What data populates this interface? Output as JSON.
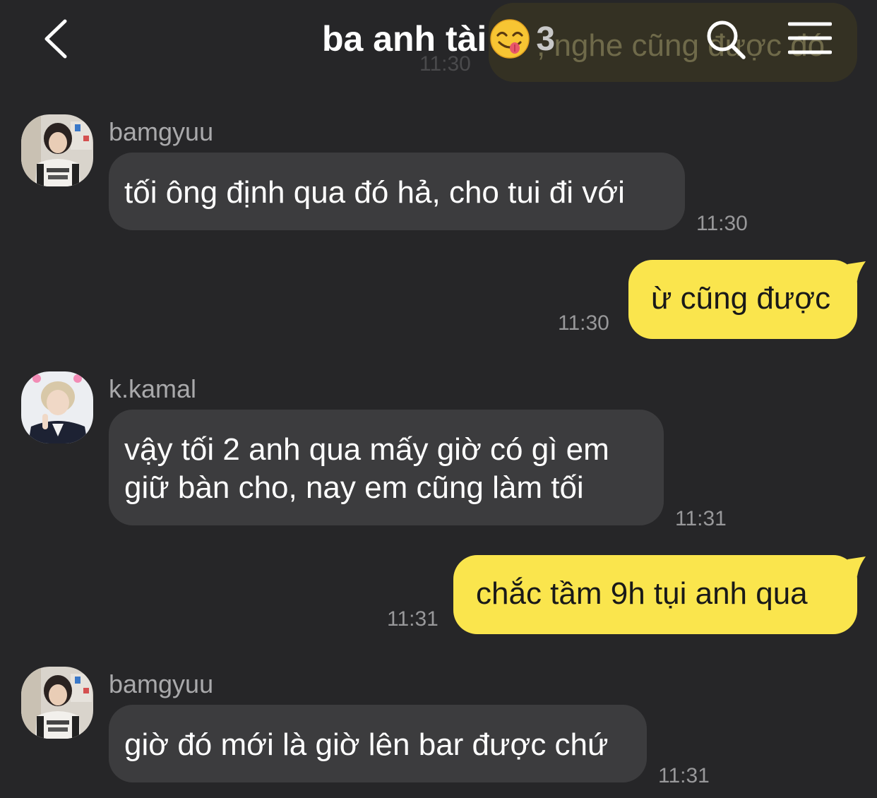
{
  "header": {
    "title": "ba anh tài",
    "member_count": "3",
    "behind_preview": {
      "text": ", nghe cũng được đó",
      "time": "11:30"
    }
  },
  "messages": [
    {
      "sender": "bamgyuu",
      "text": "tối ông định qua đó hả, cho tui đi với",
      "time": "11:30",
      "direction": "incoming"
    },
    {
      "text": "ừ cũng được",
      "time": "11:30",
      "direction": "outgoing"
    },
    {
      "sender": "k.kamal",
      "text_line1": "vậy tối 2 anh qua mấy giờ có gì em",
      "text_line2": "giữ bàn cho, nay em cũng làm tối",
      "time": "11:31",
      "direction": "incoming"
    },
    {
      "text": "chắc tầm 9h tụi anh qua",
      "time": "11:31",
      "direction": "outgoing"
    },
    {
      "sender": "bamgyuu",
      "text": "giờ đó mới là giờ lên bar được chứ",
      "time": "11:31",
      "direction": "incoming"
    }
  ],
  "colors": {
    "background": "#262628",
    "incoming_bubble": "#3c3c3e",
    "outgoing_bubble": "#fae54d",
    "timestamp": "#98989a",
    "sender_name": "#a9a9ab"
  },
  "icons": {
    "back": "chevron-left-icon",
    "search": "search-icon",
    "menu": "hamburger-menu-icon",
    "title_emoji": "yum-face-emoji"
  }
}
